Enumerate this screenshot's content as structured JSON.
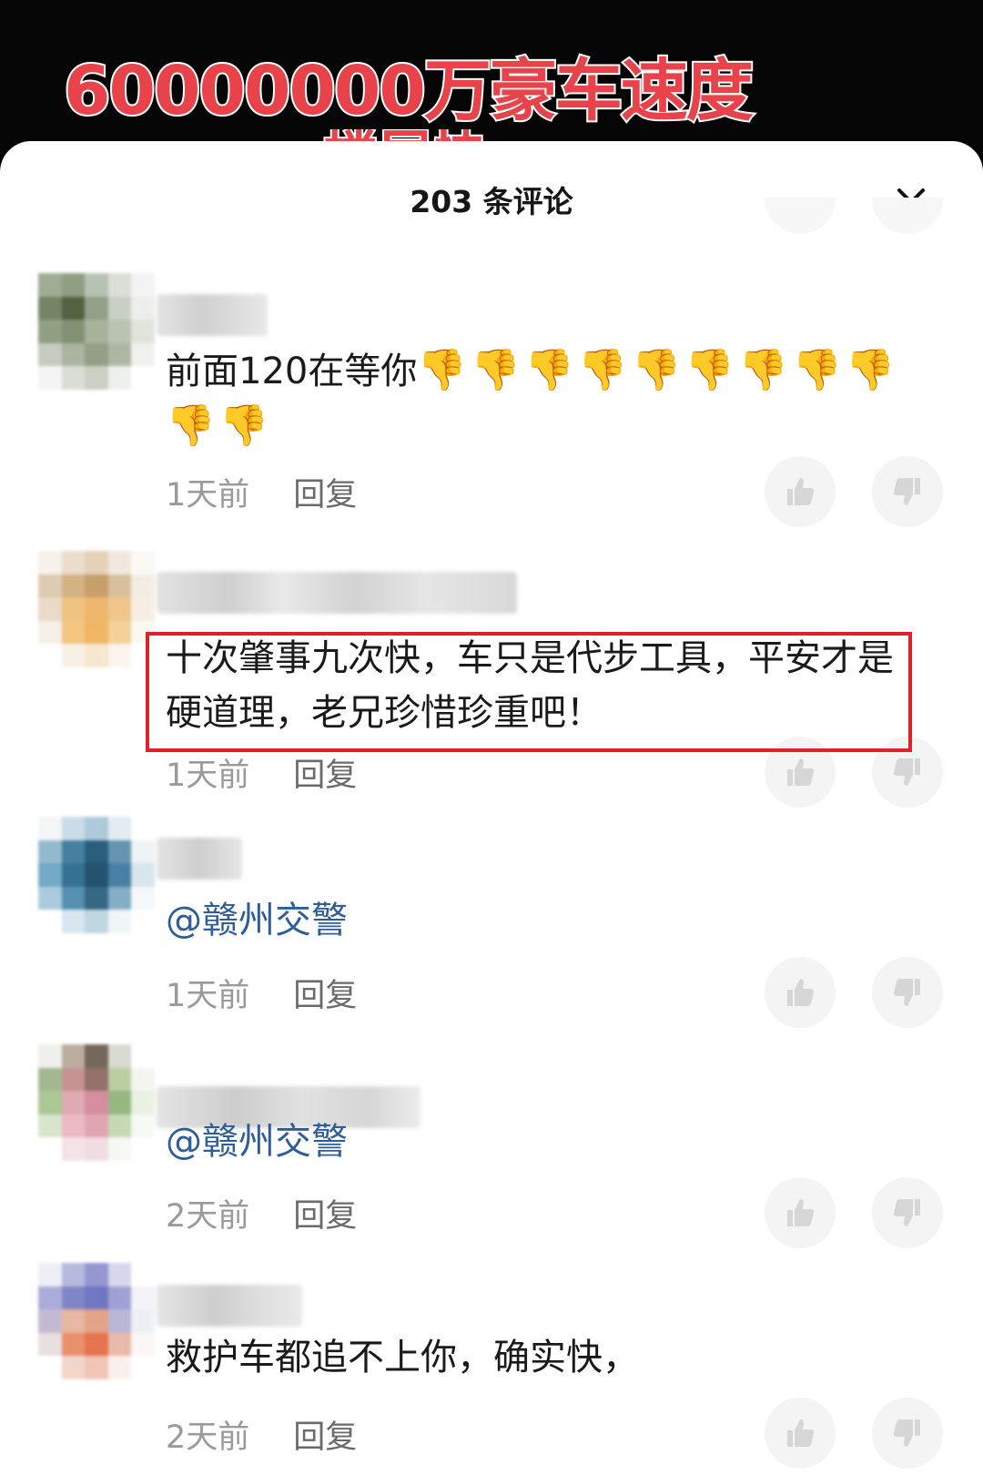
{
  "video": {
    "title": "60000000万豪车速度",
    "subtitle_peek": "楼层快"
  },
  "sheet": {
    "title": "203 条评论",
    "close_icon": "close-icon"
  },
  "comments": [
    {
      "text": "前面120在等你",
      "emoji": "👎",
      "emoji_count": 11,
      "time": "1天前",
      "reply": "回复"
    },
    {
      "text": "十次肇事九次快，车只是代步工具，平安才是硬道理，老兄珍惜珍重吧！",
      "time": "1天前",
      "reply": "回复",
      "highlighted": true
    },
    {
      "text": "@赣州交警",
      "time": "1天前",
      "reply": "回复"
    },
    {
      "text": "@赣州交警",
      "time": "2天前",
      "reply": "回复"
    },
    {
      "text": "救护车都追不上你，确实快，",
      "time": "2天前",
      "reply": "回复"
    }
  ],
  "colors": {
    "highlight": "#e0202a",
    "mention": "#2f5d9a",
    "title_red": "#e8434a"
  }
}
